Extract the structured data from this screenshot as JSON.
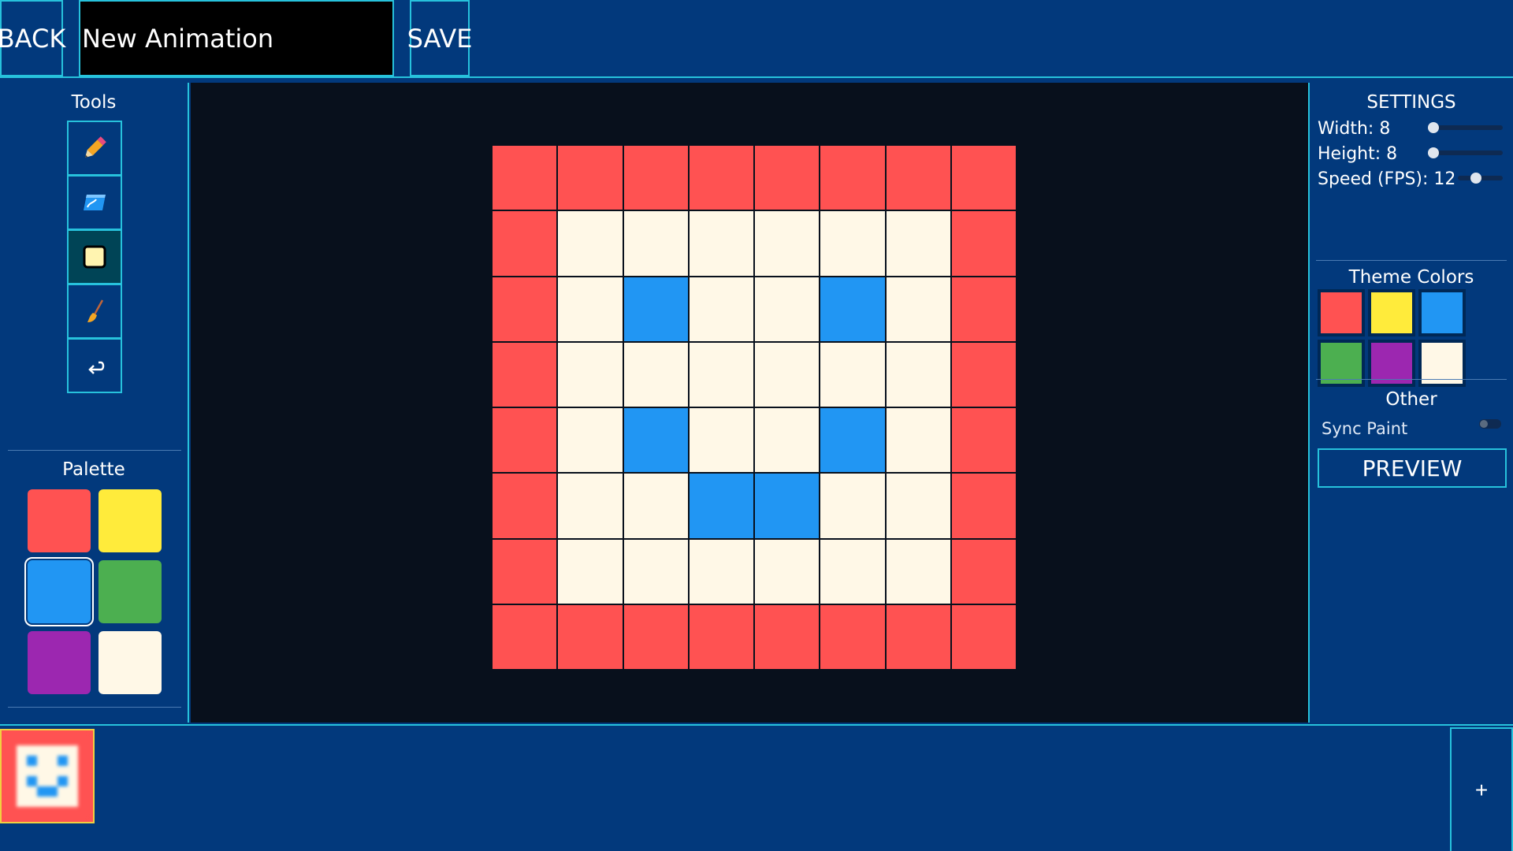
{
  "topbar": {
    "back_label": "BACK",
    "title_value": "New Animation",
    "save_label": "SAVE"
  },
  "tools": {
    "heading": "Tools",
    "items": [
      {
        "name": "pencil",
        "icon": "pencil-icon"
      },
      {
        "name": "eraser",
        "icon": "eraser-icon"
      },
      {
        "name": "fill-square",
        "icon": "square-icon"
      },
      {
        "name": "brush",
        "icon": "brush-icon"
      },
      {
        "name": "undo",
        "icon": "undo-icon"
      }
    ],
    "active_index": 2
  },
  "palette": {
    "heading": "Palette",
    "colors": [
      "#ff5252",
      "#ffeb3b",
      "#2196f3",
      "#4caf50",
      "#9c27b0",
      "#fff8e7"
    ],
    "selected_index": 2
  },
  "canvas": {
    "width": 8,
    "height": 8,
    "colors": {
      "R": "#ff5252",
      "W": "#fff8e7",
      "B": "#2196f3"
    },
    "rows": [
      "RRRRRRRR",
      "RWWWWWWR",
      "RWBWWBWR",
      "RWWWWWWR",
      "RWBWWBWR",
      "RWWBBWWR",
      "RWWWWWWR",
      "RRRRRRRR"
    ]
  },
  "settings": {
    "heading": "SETTINGS",
    "width_label": "Width: 8",
    "width_level": 0.0,
    "height_label": "Height: 8",
    "height_level": 0.0,
    "speed_label": "Speed (FPS): 12",
    "speed_level": 0.4,
    "theme_heading": "Theme Colors",
    "theme_colors": [
      "#ff5252",
      "#ffeb3b",
      "#2196f3",
      "#4caf50",
      "#9c27b0",
      "#fff8e7"
    ],
    "other_heading": "Other",
    "sync_paint_label": "Sync Paint",
    "sync_paint_on": false,
    "preview_label": "PREVIEW"
  },
  "timeline": {
    "frames": [
      {
        "index": 1,
        "selected": true
      }
    ],
    "add_label": "+"
  }
}
